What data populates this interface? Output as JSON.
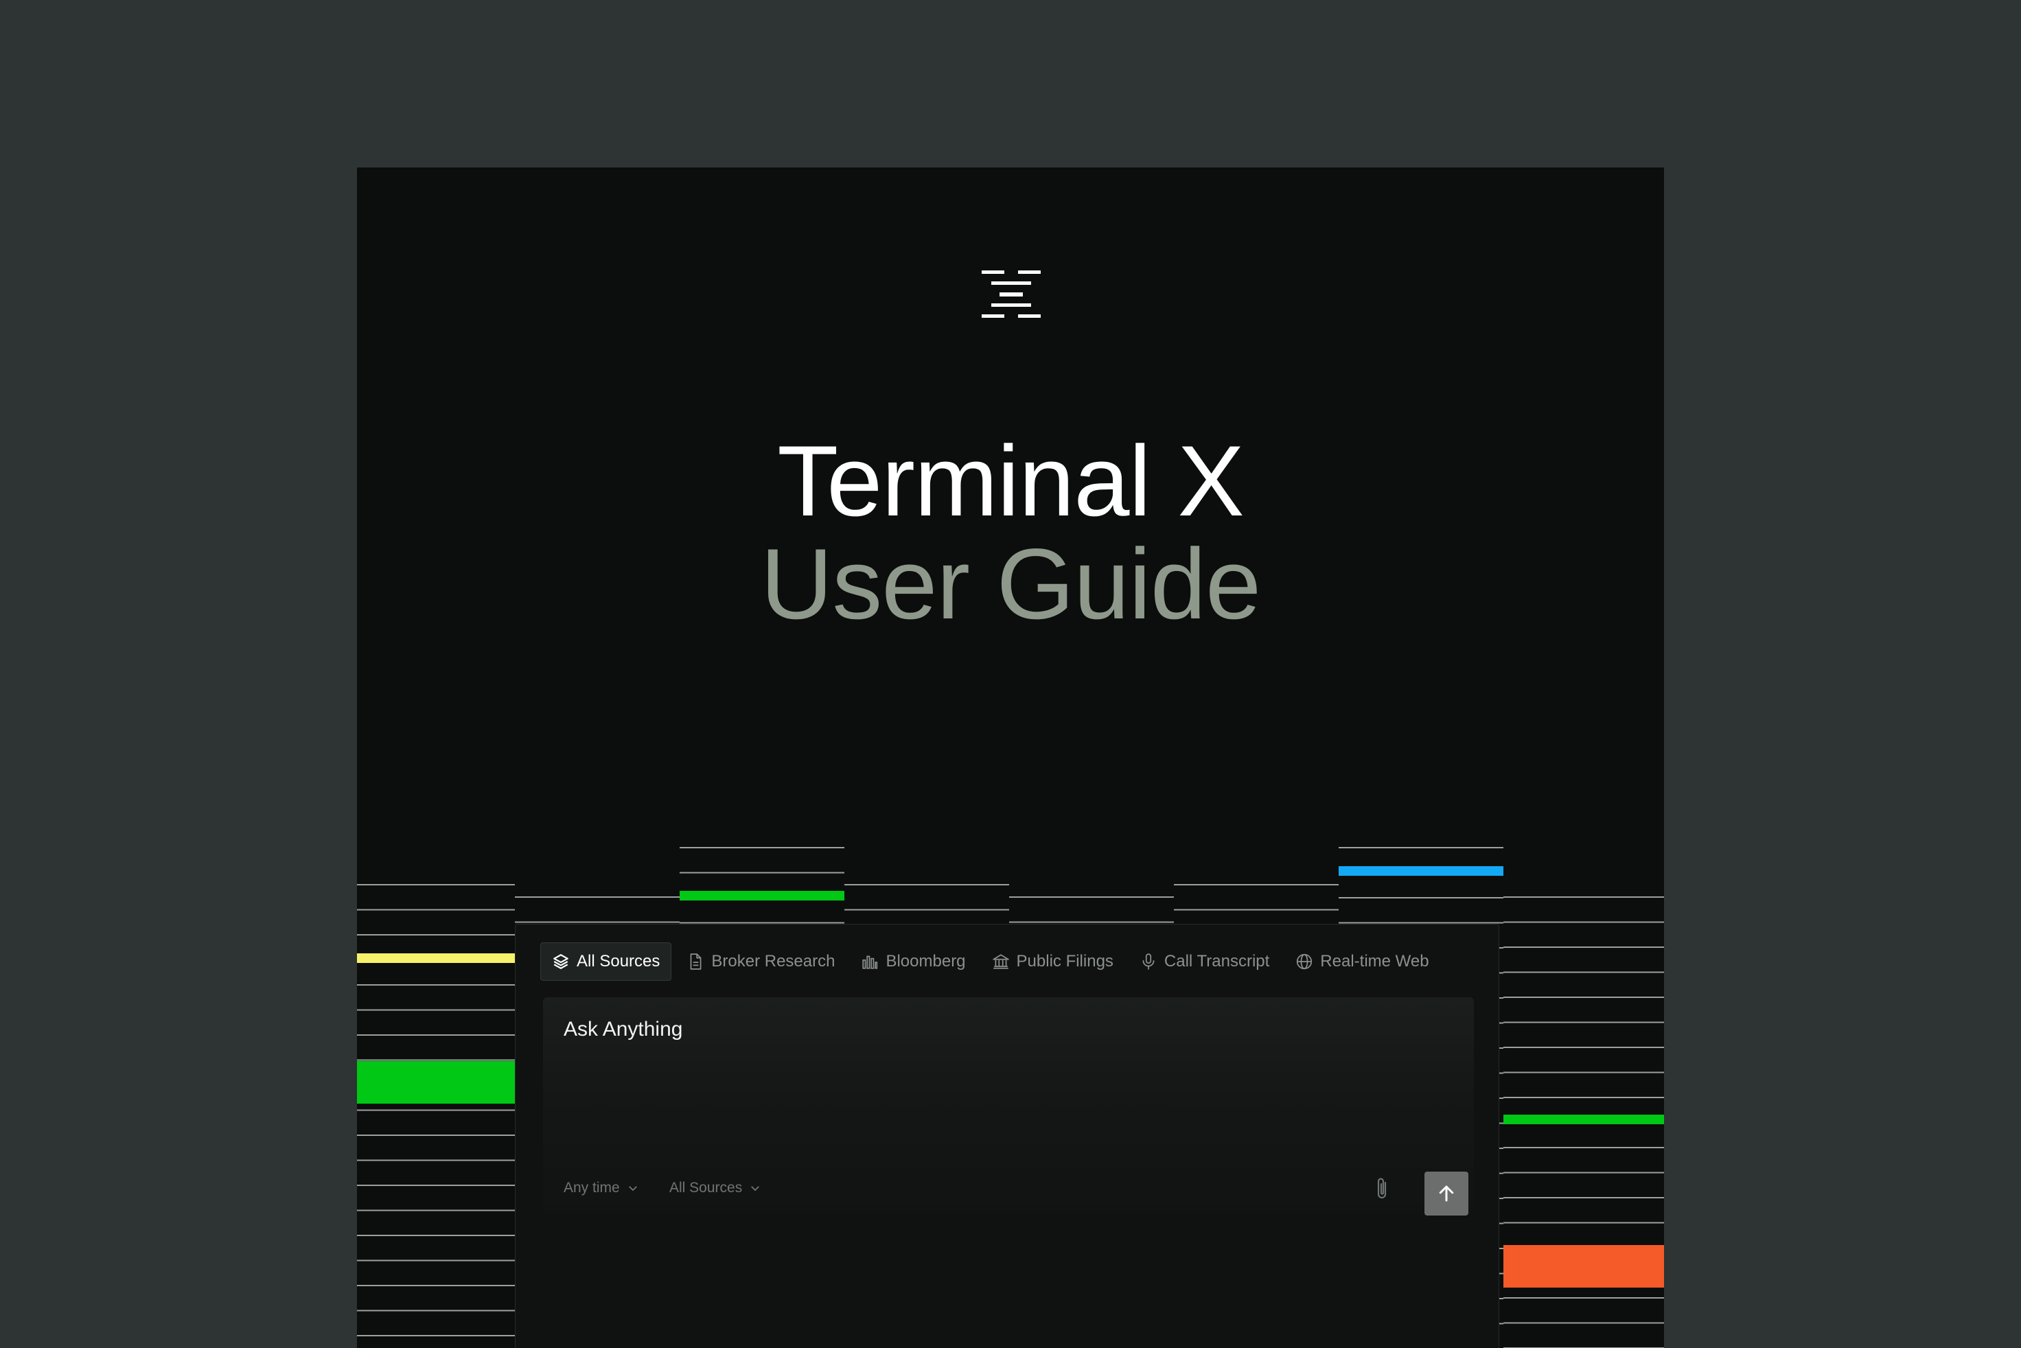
{
  "document": {
    "title": "Terminal X",
    "subtitle": "User Guide"
  },
  "search_panel": {
    "source_tabs": [
      {
        "label": "All Sources",
        "icon": "layers-icon",
        "active": true
      },
      {
        "label": "Broker Research",
        "icon": "document-icon",
        "active": false
      },
      {
        "label": "Bloomberg",
        "icon": "bar-chart-icon",
        "active": false
      },
      {
        "label": "Public Filings",
        "icon": "bank-icon",
        "active": false
      },
      {
        "label": "Call Transcript",
        "icon": "microphone-icon",
        "active": false
      },
      {
        "label": "Real-time Web",
        "icon": "globe-icon",
        "active": false
      }
    ],
    "prompt_text": "Ask Anything",
    "time_filter": "Any time",
    "source_filter": "All Sources",
    "attach_icon": "paperclip-icon",
    "send_icon": "arrow-up-icon"
  },
  "colors": {
    "background": "#2d3433",
    "card": "#0c0e0d",
    "title": "#ffffff",
    "subtitle": "#8e998b",
    "accent_yellow": "#f7f06a",
    "accent_green": "#00c814",
    "accent_blue": "#13a9f5",
    "accent_red": "#ff2a4f",
    "accent_orange": "#f55a29"
  }
}
